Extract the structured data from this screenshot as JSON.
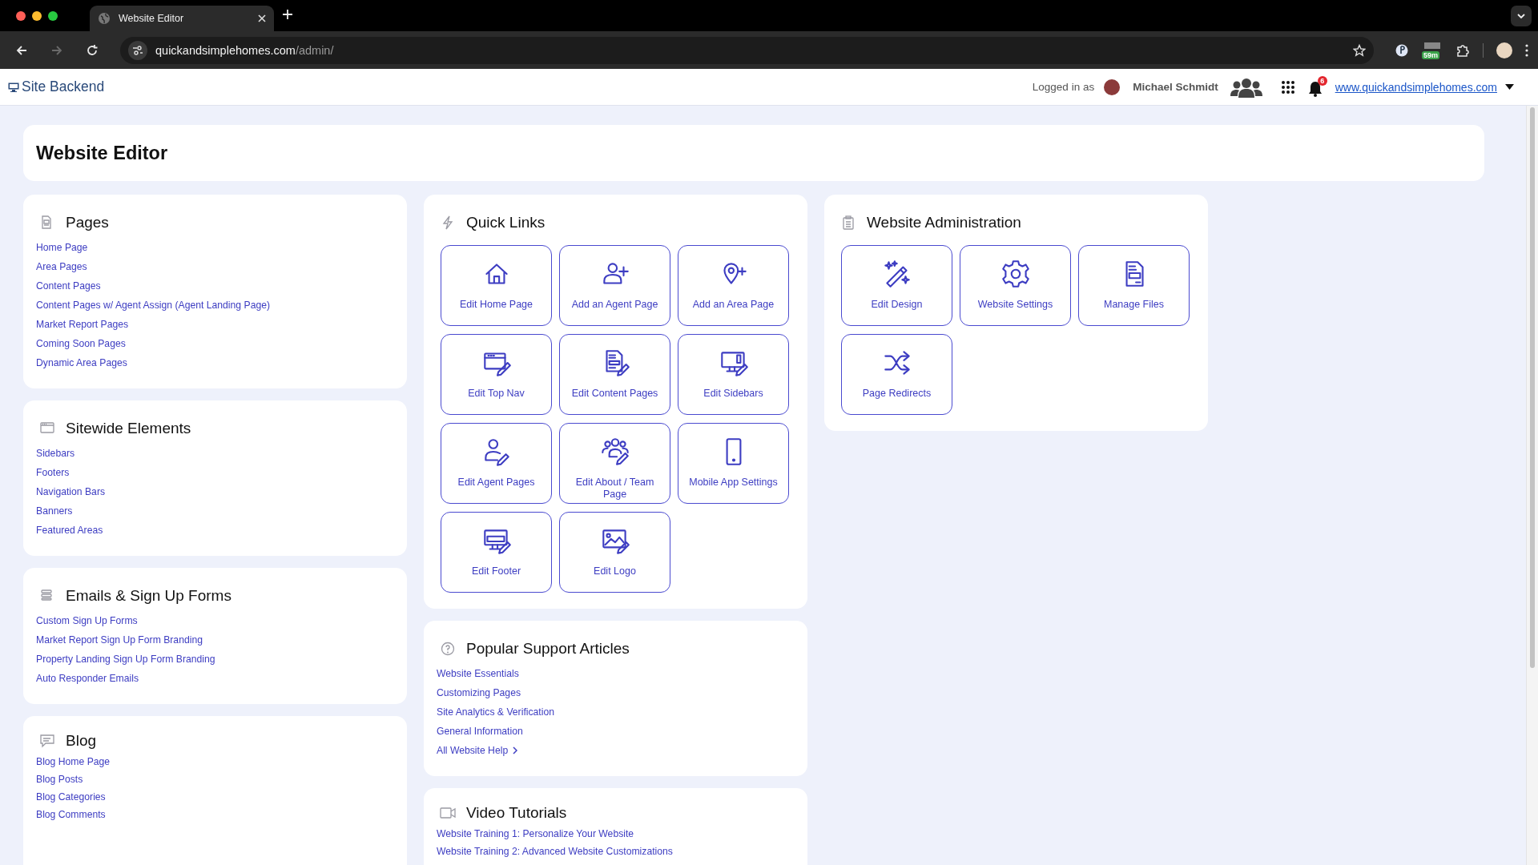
{
  "browser": {
    "tab_title": "Website Editor",
    "url_host": "quickandsimplehomes.com",
    "url_path": "/admin/",
    "forward_disabled": true,
    "extension_badge": "59m"
  },
  "header": {
    "brand": "Site Backend",
    "logged_in_label": "Logged in as",
    "user_name": "Michael Schmidt",
    "notification_count": "6",
    "site_link": "www.quickandsimplehomes.com"
  },
  "page_title": "Website Editor",
  "left_column": [
    {
      "title": "Pages",
      "links": [
        "Home Page",
        "Area Pages",
        "Content Pages",
        "Content Pages w/ Agent Assign (Agent Landing Page)",
        "Market Report Pages",
        "Coming Soon Pages",
        "Dynamic Area Pages"
      ]
    },
    {
      "title": "Sitewide Elements",
      "links": [
        "Sidebars",
        "Footers",
        "Navigation Bars",
        "Banners",
        "Featured Areas"
      ]
    },
    {
      "title": "Emails & Sign Up Forms",
      "links": [
        "Custom Sign Up Forms",
        "Market Report Sign Up Form Branding",
        "Property Landing Sign Up Form Branding",
        "Auto Responder Emails"
      ]
    },
    {
      "title": "Blog",
      "links": [
        "Blog Home Page",
        "Blog Posts",
        "Blog Categories",
        "Blog Comments"
      ]
    }
  ],
  "quick_links": {
    "title": "Quick Links",
    "tiles": [
      {
        "label": "Edit Home Page"
      },
      {
        "label": "Add an Agent Page"
      },
      {
        "label": "Add an Area Page"
      },
      {
        "label": "Edit Top Nav"
      },
      {
        "label": "Edit Content Pages"
      },
      {
        "label": "Edit Sidebars"
      },
      {
        "label": "Edit Agent Pages"
      },
      {
        "label": "Edit About / Team Page"
      },
      {
        "label": "Mobile App Settings"
      },
      {
        "label": "Edit Footer"
      },
      {
        "label": "Edit Logo"
      }
    ]
  },
  "support_articles": {
    "title": "Popular Support Articles",
    "links": [
      {
        "label": "Website Essentials",
        "kind": "plain"
      },
      {
        "label": "Customizing Pages",
        "kind": "plain"
      },
      {
        "label": "Site Analytics & Verification",
        "kind": "plain"
      },
      {
        "label": "General Information",
        "kind": "plain"
      },
      {
        "label": "All Website Help",
        "kind": "more"
      }
    ]
  },
  "video_tutorials": {
    "title": "Video Tutorials",
    "links": [
      "Website Training 1: Personalize Your Website",
      "Website Training 2: Advanced Website Customizations"
    ]
  },
  "website_administration": {
    "title": "Website Administration",
    "tiles": [
      {
        "label": "Edit Design"
      },
      {
        "label": "Website Settings"
      },
      {
        "label": "Manage Files"
      },
      {
        "label": "Page Redirects"
      }
    ]
  }
}
